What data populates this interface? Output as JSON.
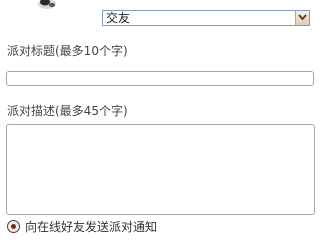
{
  "party_type_select": {
    "selected": "交友"
  },
  "title_field": {
    "label": "派对标题(最多10个字)",
    "value": ""
  },
  "description_field": {
    "label": "派对描述(最多45个字)",
    "value": ""
  },
  "notify_option": {
    "label": "向在线好友发送派对通知",
    "checked": true
  },
  "icons": {
    "avatar": "avatar-icon",
    "dropdown": "chevron-down-icon",
    "radio": "radio-selected-icon"
  },
  "colors": {
    "dropdown_arrow_bg": "#d8ceb6",
    "radio_dot": "#6b2f1f"
  }
}
